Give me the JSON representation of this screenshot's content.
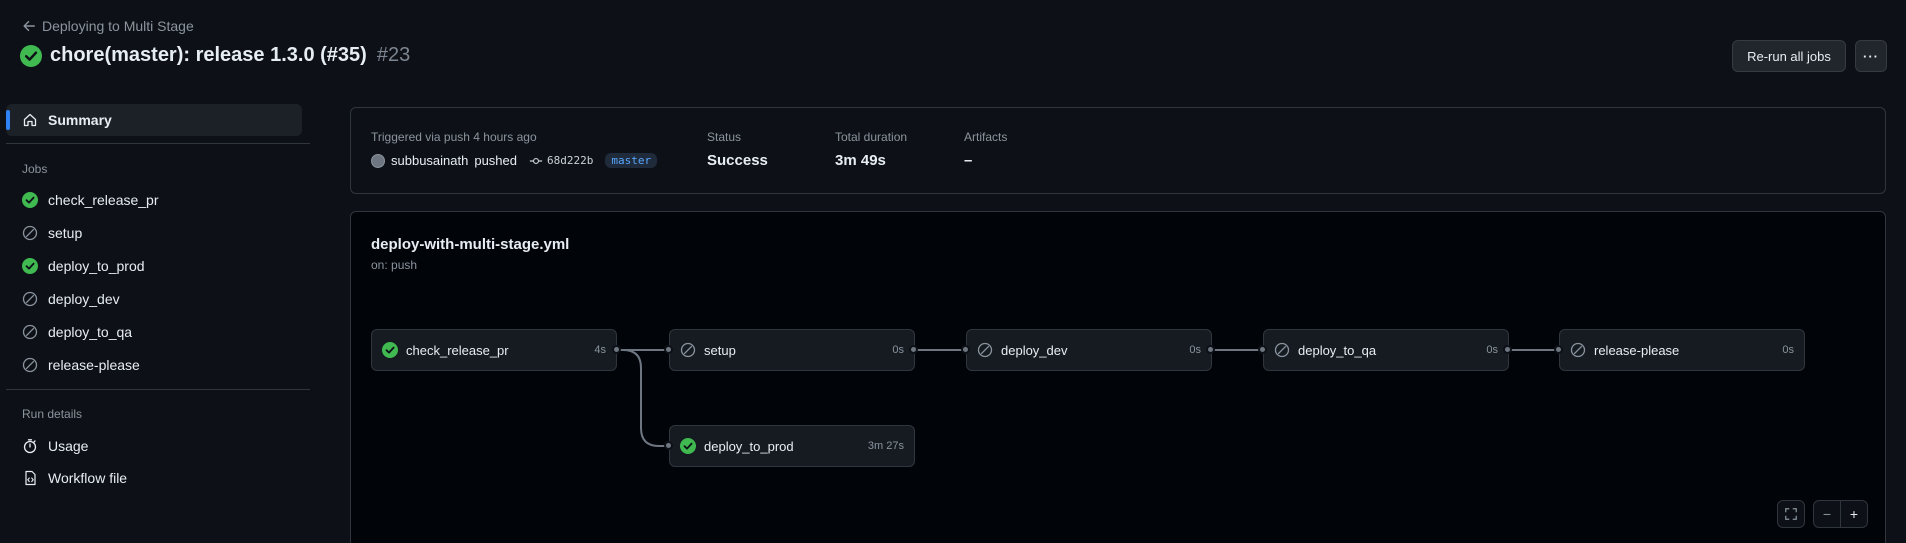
{
  "header": {
    "back_label": "Deploying to Multi Stage",
    "run_title": "chore(master): release 1.3.0 (#35)",
    "run_number": "#23",
    "rerun_label": "Re-run all jobs",
    "more_label": "···"
  },
  "sidebar": {
    "summary_label": "Summary",
    "jobs_heading": "Jobs",
    "jobs": [
      {
        "label": "check_release_pr",
        "status": "success"
      },
      {
        "label": "setup",
        "status": "skipped"
      },
      {
        "label": "deploy_to_prod",
        "status": "success"
      },
      {
        "label": "deploy_dev",
        "status": "skipped"
      },
      {
        "label": "deploy_to_qa",
        "status": "skipped"
      },
      {
        "label": "release-please",
        "status": "skipped"
      }
    ],
    "run_details_heading": "Run details",
    "run_details": [
      {
        "label": "Usage",
        "icon": "stopwatch-icon"
      },
      {
        "label": "Workflow file",
        "icon": "file-code-icon"
      }
    ]
  },
  "summary": {
    "trigger_label": "Triggered via push 4 hours ago",
    "user": "subbusainath",
    "action": "pushed",
    "sha": "68d222b",
    "branch": "master",
    "status_label": "Status",
    "status_value": "Success",
    "duration_label": "Total duration",
    "duration_value": "3m 49s",
    "artifacts_label": "Artifacts",
    "artifacts_value": "–"
  },
  "workflow": {
    "file": "deploy-with-multi-stage.yml",
    "trigger": "on: push",
    "jobs": [
      {
        "name": "check_release_pr",
        "duration": "4s",
        "status": "success"
      },
      {
        "name": "setup",
        "duration": "0s",
        "status": "skipped"
      },
      {
        "name": "deploy_dev",
        "duration": "0s",
        "status": "skipped"
      },
      {
        "name": "deploy_to_qa",
        "duration": "0s",
        "status": "skipped"
      },
      {
        "name": "release-please",
        "duration": "0s",
        "status": "skipped"
      },
      {
        "name": "deploy_to_prod",
        "duration": "3m 27s",
        "status": "success"
      }
    ],
    "zoom_out_label": "−",
    "zoom_in_label": "+"
  },
  "colors": {
    "success": "#3fb950",
    "skipped": "#8b949e",
    "accent": "#2f81f7"
  }
}
